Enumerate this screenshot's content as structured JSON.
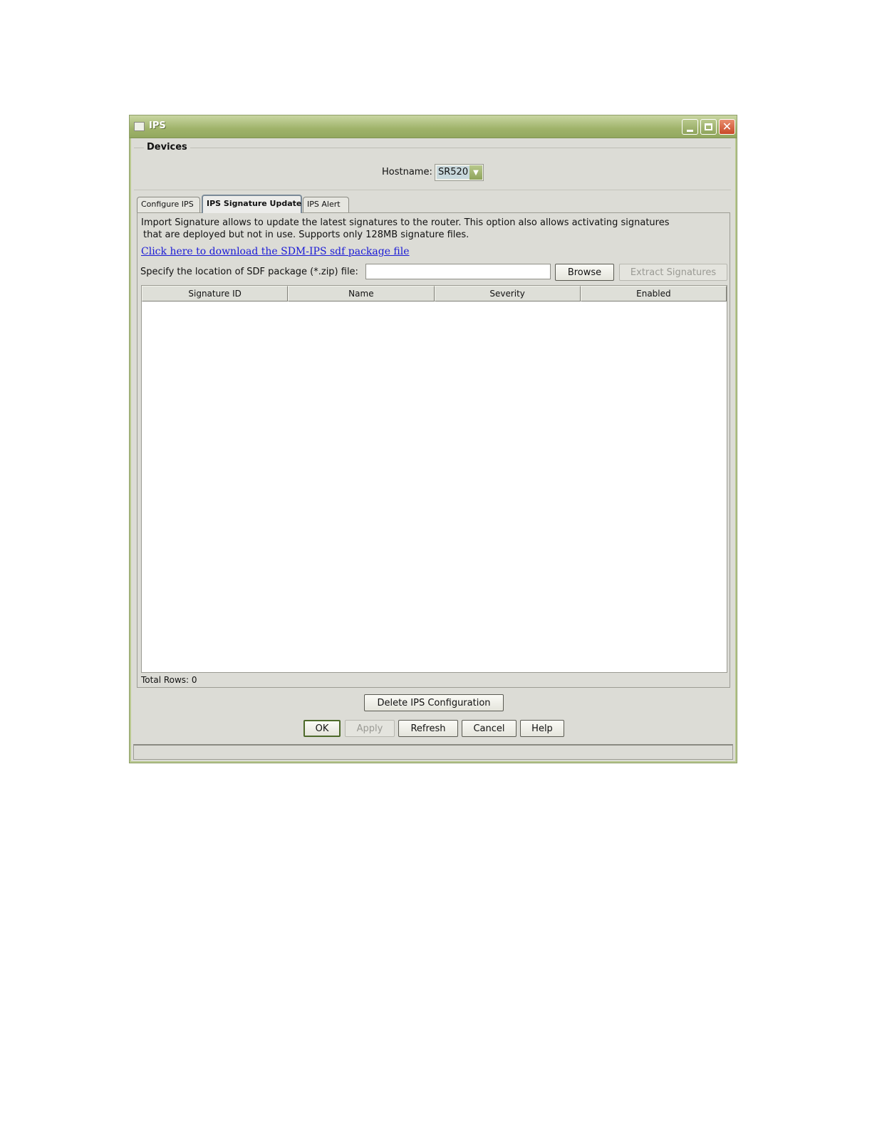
{
  "window": {
    "title": "IPS",
    "controls": {
      "minimize": "minimize-icon",
      "maximize": "maximize-icon",
      "close": "close-icon"
    }
  },
  "devices": {
    "group_label": "Devices",
    "hostname_label": "Hostname:",
    "hostname_value": "SR520"
  },
  "tabs": [
    {
      "label": "Configure IPS",
      "active": false
    },
    {
      "label": "IPS Signature Update",
      "active": true
    },
    {
      "label": "IPS Alert",
      "active": false
    }
  ],
  "signature_update": {
    "info_line1": "Import Signature allows to update the latest signatures to the router. This option also allows activating signatures",
    "info_line2": "that are deployed but not in use. Supports only 128MB signature files.",
    "download_link": "Click here to download the SDM-IPS sdf package file",
    "sdf_label": "Specify the location of SDF package (*.zip) file:",
    "sdf_value": "",
    "browse_label": "Browse",
    "extract_label": "Extract Signatures",
    "table": {
      "columns": [
        "Signature ID",
        "Name",
        "Severity",
        "Enabled"
      ],
      "rows": []
    },
    "total_rows": "Total Rows: 0"
  },
  "actions": {
    "delete_label": "Delete IPS Configuration",
    "ok_label": "OK",
    "apply_label": "Apply",
    "refresh_label": "Refresh",
    "cancel_label": "Cancel",
    "help_label": "Help"
  }
}
